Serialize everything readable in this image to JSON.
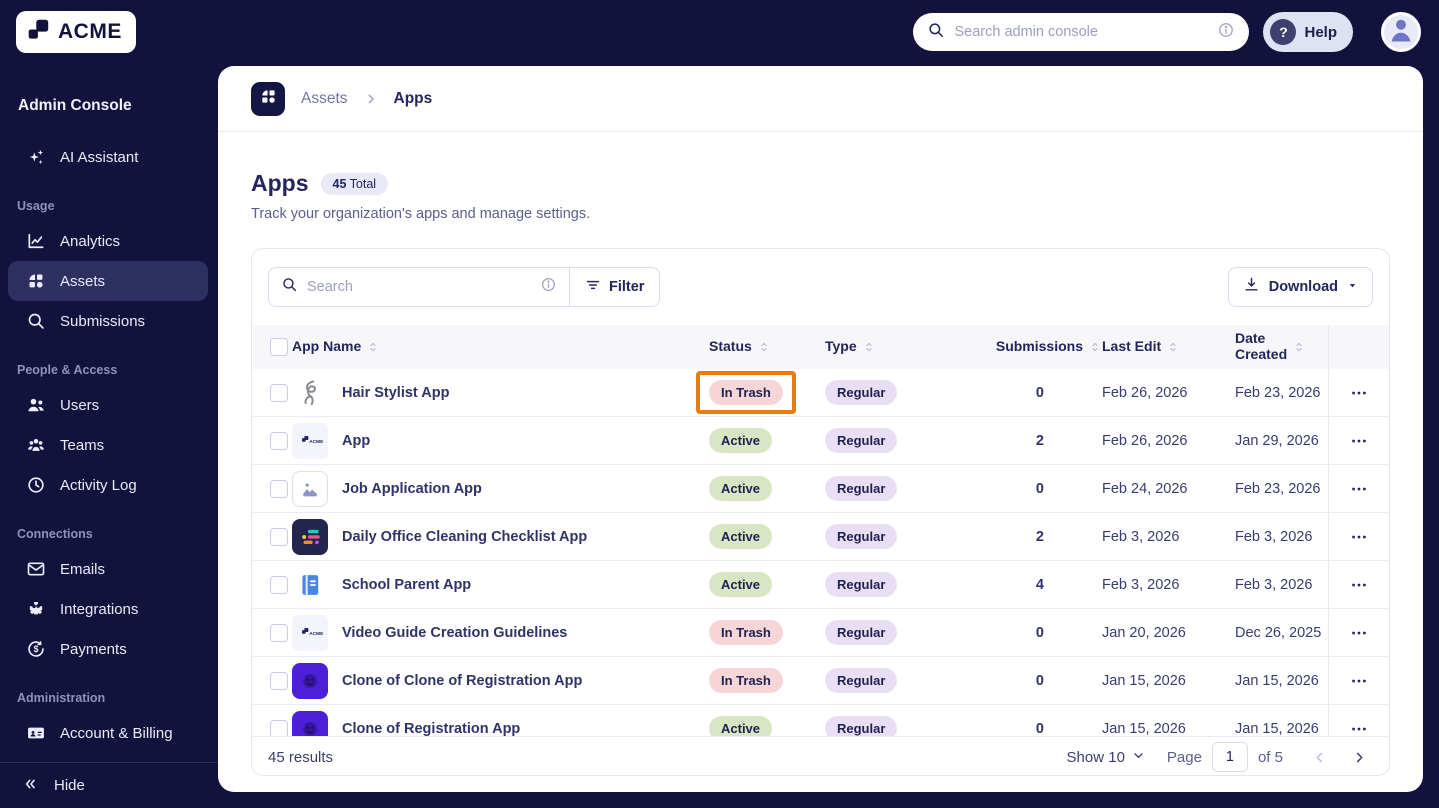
{
  "colors": {
    "navy_bg": "#12123d",
    "sidebar_active_bg": "#2d3061",
    "highlight_orange": "#ea7a12",
    "badge_active_bg": "#d9e6c6",
    "badge_trash_bg": "#f6d5d7",
    "badge_type_bg": "#e8dff4",
    "robot_icon_bg": "#4c1fd9",
    "checklist_icon_bg": "#23254f"
  },
  "topbar": {
    "logo_text": "ACME",
    "search_placeholder": "Search admin console",
    "help_label": "Help"
  },
  "sidebar": {
    "title": "Admin Console",
    "sections": [
      {
        "label": "",
        "items": [
          {
            "label": "AI Assistant",
            "icon": "sparkles",
            "active": false
          }
        ]
      },
      {
        "label": "Usage",
        "items": [
          {
            "label": "Analytics",
            "icon": "analytics",
            "active": false
          },
          {
            "label": "Assets",
            "icon": "assets",
            "active": true
          },
          {
            "label": "Submissions",
            "icon": "search",
            "active": false
          }
        ]
      },
      {
        "label": "People & Access",
        "items": [
          {
            "label": "Users",
            "icon": "users",
            "active": false
          },
          {
            "label": "Teams",
            "icon": "teams",
            "active": false
          },
          {
            "label": "Activity Log",
            "icon": "clock",
            "active": false
          }
        ]
      },
      {
        "label": "Connections",
        "items": [
          {
            "label": "Emails",
            "icon": "mail",
            "active": false
          },
          {
            "label": "Integrations",
            "icon": "puzzle",
            "active": false
          },
          {
            "label": "Payments",
            "icon": "payments",
            "active": false
          }
        ]
      },
      {
        "label": "Administration",
        "items": [
          {
            "label": "Account & Billing",
            "icon": "idcard",
            "active": false
          }
        ]
      }
    ],
    "hide_label": "Hide"
  },
  "breadcrumb": {
    "parent": "Assets",
    "current": "Apps"
  },
  "page": {
    "title": "Apps",
    "total_count": "45",
    "total_suffix": "Total",
    "subtitle": "Track your organization's apps and manage settings."
  },
  "toolbar": {
    "search_placeholder": "Search",
    "filter_label": "Filter",
    "download_label": "Download"
  },
  "table": {
    "columns": [
      {
        "label": "App Name"
      },
      {
        "label": "Status"
      },
      {
        "label": "Type"
      },
      {
        "label": "Submissions"
      },
      {
        "label": "Last Edit"
      },
      {
        "label": "Date Created"
      }
    ],
    "rows": [
      {
        "name": "Hair Stylist App",
        "icon": "hair",
        "status": "In Trash",
        "type": "Regular",
        "submissions": "0",
        "last_edit": "Feb 26, 2026",
        "date_created": "Feb 23, 2026",
        "highlighted": true
      },
      {
        "name": "App",
        "icon": "acme",
        "status": "Active",
        "type": "Regular",
        "submissions": "2",
        "last_edit": "Feb 26, 2026",
        "date_created": "Jan 29, 2026",
        "highlighted": false
      },
      {
        "name": "Job Application App",
        "icon": "image",
        "status": "Active",
        "type": "Regular",
        "submissions": "0",
        "last_edit": "Feb 24, 2026",
        "date_created": "Feb 23, 2026",
        "highlighted": false
      },
      {
        "name": "Daily Office Cleaning Checklist App",
        "icon": "checklist",
        "status": "Active",
        "type": "Regular",
        "submissions": "2",
        "last_edit": "Feb 3, 2026",
        "date_created": "Feb 3, 2026",
        "highlighted": false
      },
      {
        "name": "School Parent App",
        "icon": "book",
        "status": "Active",
        "type": "Regular",
        "submissions": "4",
        "last_edit": "Feb 3, 2026",
        "date_created": "Feb 3, 2026",
        "highlighted": false
      },
      {
        "name": "Video Guide Creation Guidelines",
        "icon": "acme",
        "status": "In Trash",
        "type": "Regular",
        "submissions": "0",
        "last_edit": "Jan 20, 2026",
        "date_created": "Dec 26, 2025",
        "highlighted": false
      },
      {
        "name": "Clone of Clone of Registration App",
        "icon": "robot",
        "status": "In Trash",
        "type": "Regular",
        "submissions": "0",
        "last_edit": "Jan 15, 2026",
        "date_created": "Jan 15, 2026",
        "highlighted": false
      },
      {
        "name": "Clone of Registration App",
        "icon": "robot",
        "status": "Active",
        "type": "Regular",
        "submissions": "0",
        "last_edit": "Jan 15, 2026",
        "date_created": "Jan 15, 2026",
        "highlighted": false
      }
    ]
  },
  "footer": {
    "results": "45 results",
    "show_label": "Show 10",
    "page_label": "Page",
    "page_value": "1",
    "of_label": "of 5"
  }
}
